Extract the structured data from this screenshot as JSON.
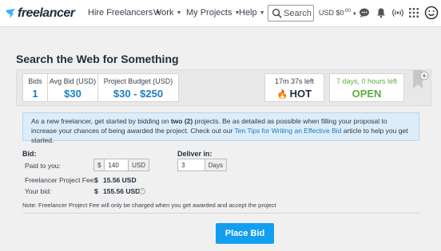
{
  "nav": {
    "logo_text": "freelancer",
    "items": [
      {
        "label": "Hire Freelancers"
      },
      {
        "label": "Work"
      },
      {
        "label": "My Projects"
      },
      {
        "label": "Help"
      }
    ],
    "search_placeholder": "Search",
    "balance": "USD $0",
    "balance_cents": ".00",
    "icons": [
      "chat-icon",
      "notification-bell-icon",
      "signal-icon",
      "apps-grid-icon",
      "avatar-smiley-icon"
    ]
  },
  "page": {
    "title": "Search the Web for Something"
  },
  "stats": {
    "bids_label": "Bids",
    "bids_value": "1",
    "avg_bid_label": "Avg Bid (USD)",
    "avg_bid_value": "$30",
    "budget_label": "Project Budget (USD)",
    "budget_value": "$30 - $250",
    "time_left_label": "17m 37s left",
    "hot_label": "HOT",
    "open_time_label": "7 days, 0 hours left",
    "open_label": "OPEN"
  },
  "banner": {
    "text_1": "As a new freelancer, get started by bidding on ",
    "bold": "two (2)",
    "text_2": " projects. Be as detailed as possible when filling your proposal to increase your chances of being awarded the project. Check out our ",
    "link": "Ten Tips for Writing an Effective Bid",
    "text_3": " article to help you get started."
  },
  "bid_form": {
    "bid_heading": "Bid:",
    "paid_label": "Paid to you:",
    "currency_prefix": "$",
    "paid_value": "140",
    "currency_suffix": "USD",
    "fee_label": "Freelancer Project Fee:",
    "fee_currency": "$",
    "fee_value": "15.56 USD",
    "your_bid_label": "Your bid:",
    "your_bid_currency": "$",
    "your_bid_value": "155.56 USD",
    "deliver_heading": "Deliver in:",
    "deliver_value": "3",
    "deliver_unit": "Days"
  },
  "note": "Note: Freelancer Project Fee will only be charged when you get awarded and accept the project",
  "place_bid_label": "Place Bid",
  "colors": {
    "accent_blue": "#139ff0",
    "stat_blue": "#1a7ec3",
    "open_green": "#5dae3f",
    "banner_bg": "#dcecf8"
  }
}
